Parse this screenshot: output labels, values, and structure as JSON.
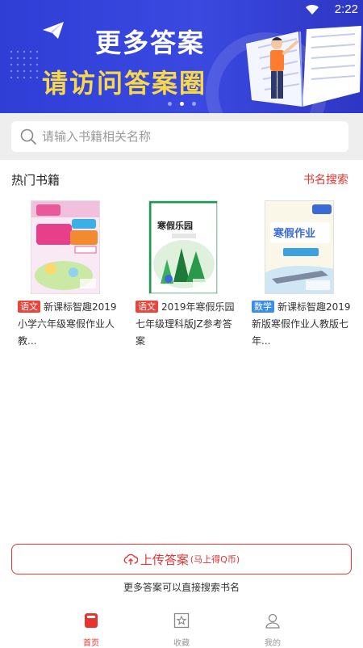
{
  "status_bar": {
    "time": "2:22"
  },
  "banner": {
    "line1": "更多答案",
    "line2": "请访问答案圈",
    "slides": 3,
    "active_slide": 1
  },
  "search": {
    "placeholder": "请输入书籍相关名称"
  },
  "hot_books": {
    "title": "热门书籍",
    "link": "书名搜索",
    "items": [
      {
        "tag": "语文",
        "tag_color": "#e8453c",
        "title": "新课标智趣2019小学六年级寒假作业人教..."
      },
      {
        "tag": "语文",
        "tag_color": "#e8453c",
        "title": "2019年寒假乐园七年级理科版JZ参考答案"
      },
      {
        "tag": "数学",
        "tag_color": "#3a8ee6",
        "title": "新课标智趣2019新版寒假作业人教版七年..."
      }
    ]
  },
  "upload": {
    "label": "上传答案",
    "sub": "(马上得Q币)",
    "hint": "更多答案可以直接搜索书名"
  },
  "tabbar": [
    {
      "label": "首页",
      "icon": "home-book-icon",
      "active": true
    },
    {
      "label": "收藏",
      "icon": "star-box-icon",
      "active": false
    },
    {
      "label": "我的",
      "icon": "user-icon",
      "active": false
    }
  ],
  "colors": {
    "accent": "#e8332f",
    "banner": "#3a49e0"
  }
}
